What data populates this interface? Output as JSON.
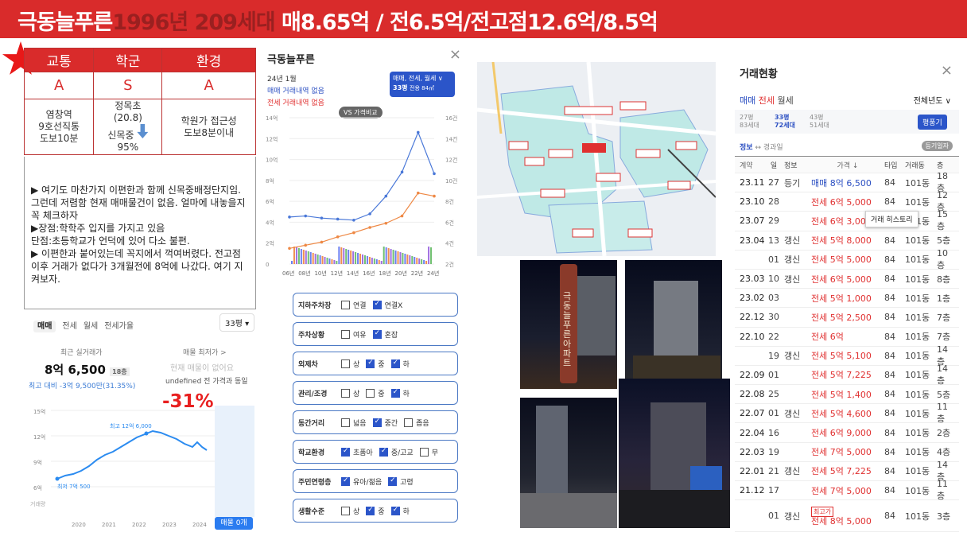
{
  "banner": {
    "name_gray": "극동늘푸른",
    "year": "1996년 209세대",
    "prices": "매8.65억 / 전6.5억/전고점12.6억/8.5억"
  },
  "score": {
    "headers": [
      "교통",
      "학군",
      "환경"
    ],
    "grades": [
      "A",
      "S",
      "A"
    ],
    "transit": [
      "염창역",
      "9호선직통",
      "도보10분"
    ],
    "school": [
      "정목초",
      "(20.8)",
      "신목중",
      "95%"
    ],
    "env": [
      "학원가 접근성",
      "도보8분이내"
    ]
  },
  "notes": [
    "▶ 여기도 마찬가지 이편한과 함께 신목중배정단지임.그런데 저렴함 현재 매매물건이 없음. 얼마에 내놓을지 꼭 체크하자",
    "▶장점:학학주 입지를 가지고 있음",
    "단점:초등학교가 언덕에 있어 다소 불편.",
    "▶ 이편한과 붙어있는데 꼭지에서 꺽여버렸다. 전고점이후 거래가 없다가 3개월전에 8억에 나갔다. 여기 지켜보자."
  ],
  "price_card": {
    "tabs": [
      "매매",
      "전세",
      "월세",
      "전세가율"
    ],
    "size_select": "33평 ▾",
    "recent_label": "최근 실거래가",
    "recent_value": "8억 6,500",
    "recent_floor": "18층",
    "recent_diff": "최고 대비 -3억 9,500만(31.35%)",
    "lowest_label": "매물 최저가 >",
    "lowest_none": "현재 매물이 없어요",
    "lowest_note": "undefined 전 가격과 동일",
    "drop_pct": "-31%",
    "high_label": "최고 12억 6,000",
    "low_label": "최저 7억 500",
    "yticks": [
      "15억",
      "12억",
      "9억",
      "6억"
    ],
    "vol_label": "거래량",
    "xticks": [
      "2020",
      "2021",
      "2022",
      "2023",
      "2024"
    ],
    "listing_btn": "매물 0개"
  },
  "mid_card": {
    "title": "극동늘푸른",
    "month": "24년 1월",
    "sale_none": "매매 거래내역 없음",
    "jeonse_none": "전세 거래내역 없음",
    "type_box": "매매, 전세, 월세 ∨",
    "size_box": "33평",
    "size_sub": "전용 84㎡",
    "vs_btn": "VS 가격비교",
    "yleft": [
      "14억",
      "12억",
      "10억",
      "8억",
      "6억",
      "4억",
      "2억",
      "0"
    ],
    "yright": [
      "16건",
      "14건",
      "12건",
      "10건",
      "8건",
      "6건",
      "4건",
      "2건"
    ],
    "xticks": [
      "06년",
      "08년",
      "10년",
      "12년",
      "14년",
      "16년",
      "18년",
      "20년",
      "22년",
      "24년"
    ]
  },
  "chart_data": {
    "type": "line",
    "title": "",
    "x": [
      "06년",
      "08년",
      "10년",
      "12년",
      "14년",
      "16년",
      "18년",
      "20년",
      "22년",
      "24년"
    ],
    "ylim": [
      0,
      14
    ],
    "series": [
      {
        "name": "매매",
        "color": "#4a78d8",
        "values": [
          4.5,
          4.6,
          4.4,
          4.3,
          4.2,
          4.8,
          6.5,
          8.8,
          12.6,
          8.65
        ]
      },
      {
        "name": "전세",
        "color": "#ee8844",
        "values": [
          1.5,
          1.8,
          2.1,
          2.6,
          3.0,
          3.5,
          3.9,
          4.6,
          6.8,
          6.5
        ]
      }
    ]
  },
  "filters": [
    {
      "label": "지하주차장",
      "opts": [
        [
          "연결",
          false
        ],
        [
          "연결X",
          true
        ]
      ]
    },
    {
      "label": "주차상황",
      "opts": [
        [
          "여유",
          false
        ],
        [
          "혼잡",
          true
        ]
      ]
    },
    {
      "label": "외제차",
      "opts": [
        [
          "상",
          false
        ],
        [
          "중",
          true
        ],
        [
          "하",
          true
        ]
      ]
    },
    {
      "label": "관리/조경",
      "opts": [
        [
          "상",
          false
        ],
        [
          "중",
          false
        ],
        [
          "하",
          true
        ]
      ]
    },
    {
      "label": "동간거리",
      "opts": [
        [
          "넓음",
          false
        ],
        [
          "중간",
          true
        ],
        [
          "좁음",
          false
        ]
      ]
    },
    {
      "label": "학교환경",
      "opts": [
        [
          "초품아",
          true
        ],
        [
          "중/고교",
          true
        ],
        [
          "무",
          false
        ]
      ]
    },
    {
      "label": "주민연령층",
      "opts": [
        [
          "유아/젊음",
          true
        ],
        [
          "고령",
          true
        ]
      ]
    },
    {
      "label": "생활수준",
      "opts": [
        [
          "상",
          false
        ],
        [
          "중",
          true
        ],
        [
          "하",
          true
        ]
      ]
    }
  ],
  "photo": {
    "sign": "극동늘푸른아파트"
  },
  "deals": {
    "title": "거래현황",
    "tabs": [
      "매매",
      "전세",
      "월세"
    ],
    "year_select": "전체년도 ∨",
    "sizes": [
      [
        "27평",
        "83세대"
      ],
      [
        "33평",
        "72세대"
      ],
      [
        "43평",
        "51세대"
      ]
    ],
    "size_btn": "평풍기",
    "info": "정보",
    "path": "↔ 경과일",
    "reg_btn": "등기일자",
    "cols": [
      "계약",
      "일",
      "정보",
      "가격 ↓",
      "타입",
      "거래동",
      "층"
    ],
    "tooltip": "거래 히스토리",
    "high_badge": "최고가",
    "rows": [
      [
        "23.11",
        "27",
        "등기",
        "매매 8억 6,500",
        "84",
        "101동",
        "18층",
        "b"
      ],
      [
        "23.10",
        "28",
        "",
        "전세 6억 5,000",
        "84",
        "101동",
        "12층",
        "r"
      ],
      [
        "23.07",
        "29",
        "",
        "전세 6억 3,000",
        "84",
        "101동",
        "15층",
        "r"
      ],
      [
        "23.04",
        "13",
        "갱신",
        "전세 5억 8,000",
        "84",
        "101동",
        "5층",
        "r"
      ],
      [
        "",
        "01",
        "갱신",
        "전세 5억 5,000",
        "84",
        "101동",
        "10층",
        "r"
      ],
      [
        "23.03",
        "10",
        "갱신",
        "전세 6억 5,000",
        "84",
        "101동",
        "8층",
        "r"
      ],
      [
        "23.02",
        "03",
        "",
        "전세 5억 1,000",
        "84",
        "101동",
        "1층",
        "r"
      ],
      [
        "22.12",
        "30",
        "",
        "전세 5억 2,500",
        "84",
        "101동",
        "7층",
        "r"
      ],
      [
        "22.10",
        "22",
        "",
        "전세 6억",
        "84",
        "101동",
        "7층",
        "r"
      ],
      [
        "",
        "19",
        "갱신",
        "전세 5억 5,100",
        "84",
        "101동",
        "14층",
        "r"
      ],
      [
        "22.09",
        "01",
        "",
        "전세 5억 7,225",
        "84",
        "101동",
        "14층",
        "r"
      ],
      [
        "22.08",
        "25",
        "",
        "전세 5억 1,400",
        "84",
        "101동",
        "5층",
        "r"
      ],
      [
        "22.07",
        "01",
        "갱신",
        "전세 5억 4,600",
        "84",
        "101동",
        "11층",
        "r"
      ],
      [
        "22.04",
        "16",
        "",
        "전세 6억 9,000",
        "84",
        "101동",
        "2층",
        "r"
      ],
      [
        "22.03",
        "19",
        "",
        "전세 7억 5,000",
        "84",
        "101동",
        "4층",
        "r"
      ],
      [
        "22.01",
        "21",
        "갱신",
        "전세 5억 7,225",
        "84",
        "101동",
        "14층",
        "r"
      ],
      [
        "21.12",
        "17",
        "",
        "전세 7억 5,000",
        "84",
        "101동",
        "11층",
        "r"
      ],
      [
        "",
        "01",
        "갱신",
        "전세 8억 5,000",
        "84",
        "101동",
        "3층",
        "r"
      ]
    ]
  }
}
